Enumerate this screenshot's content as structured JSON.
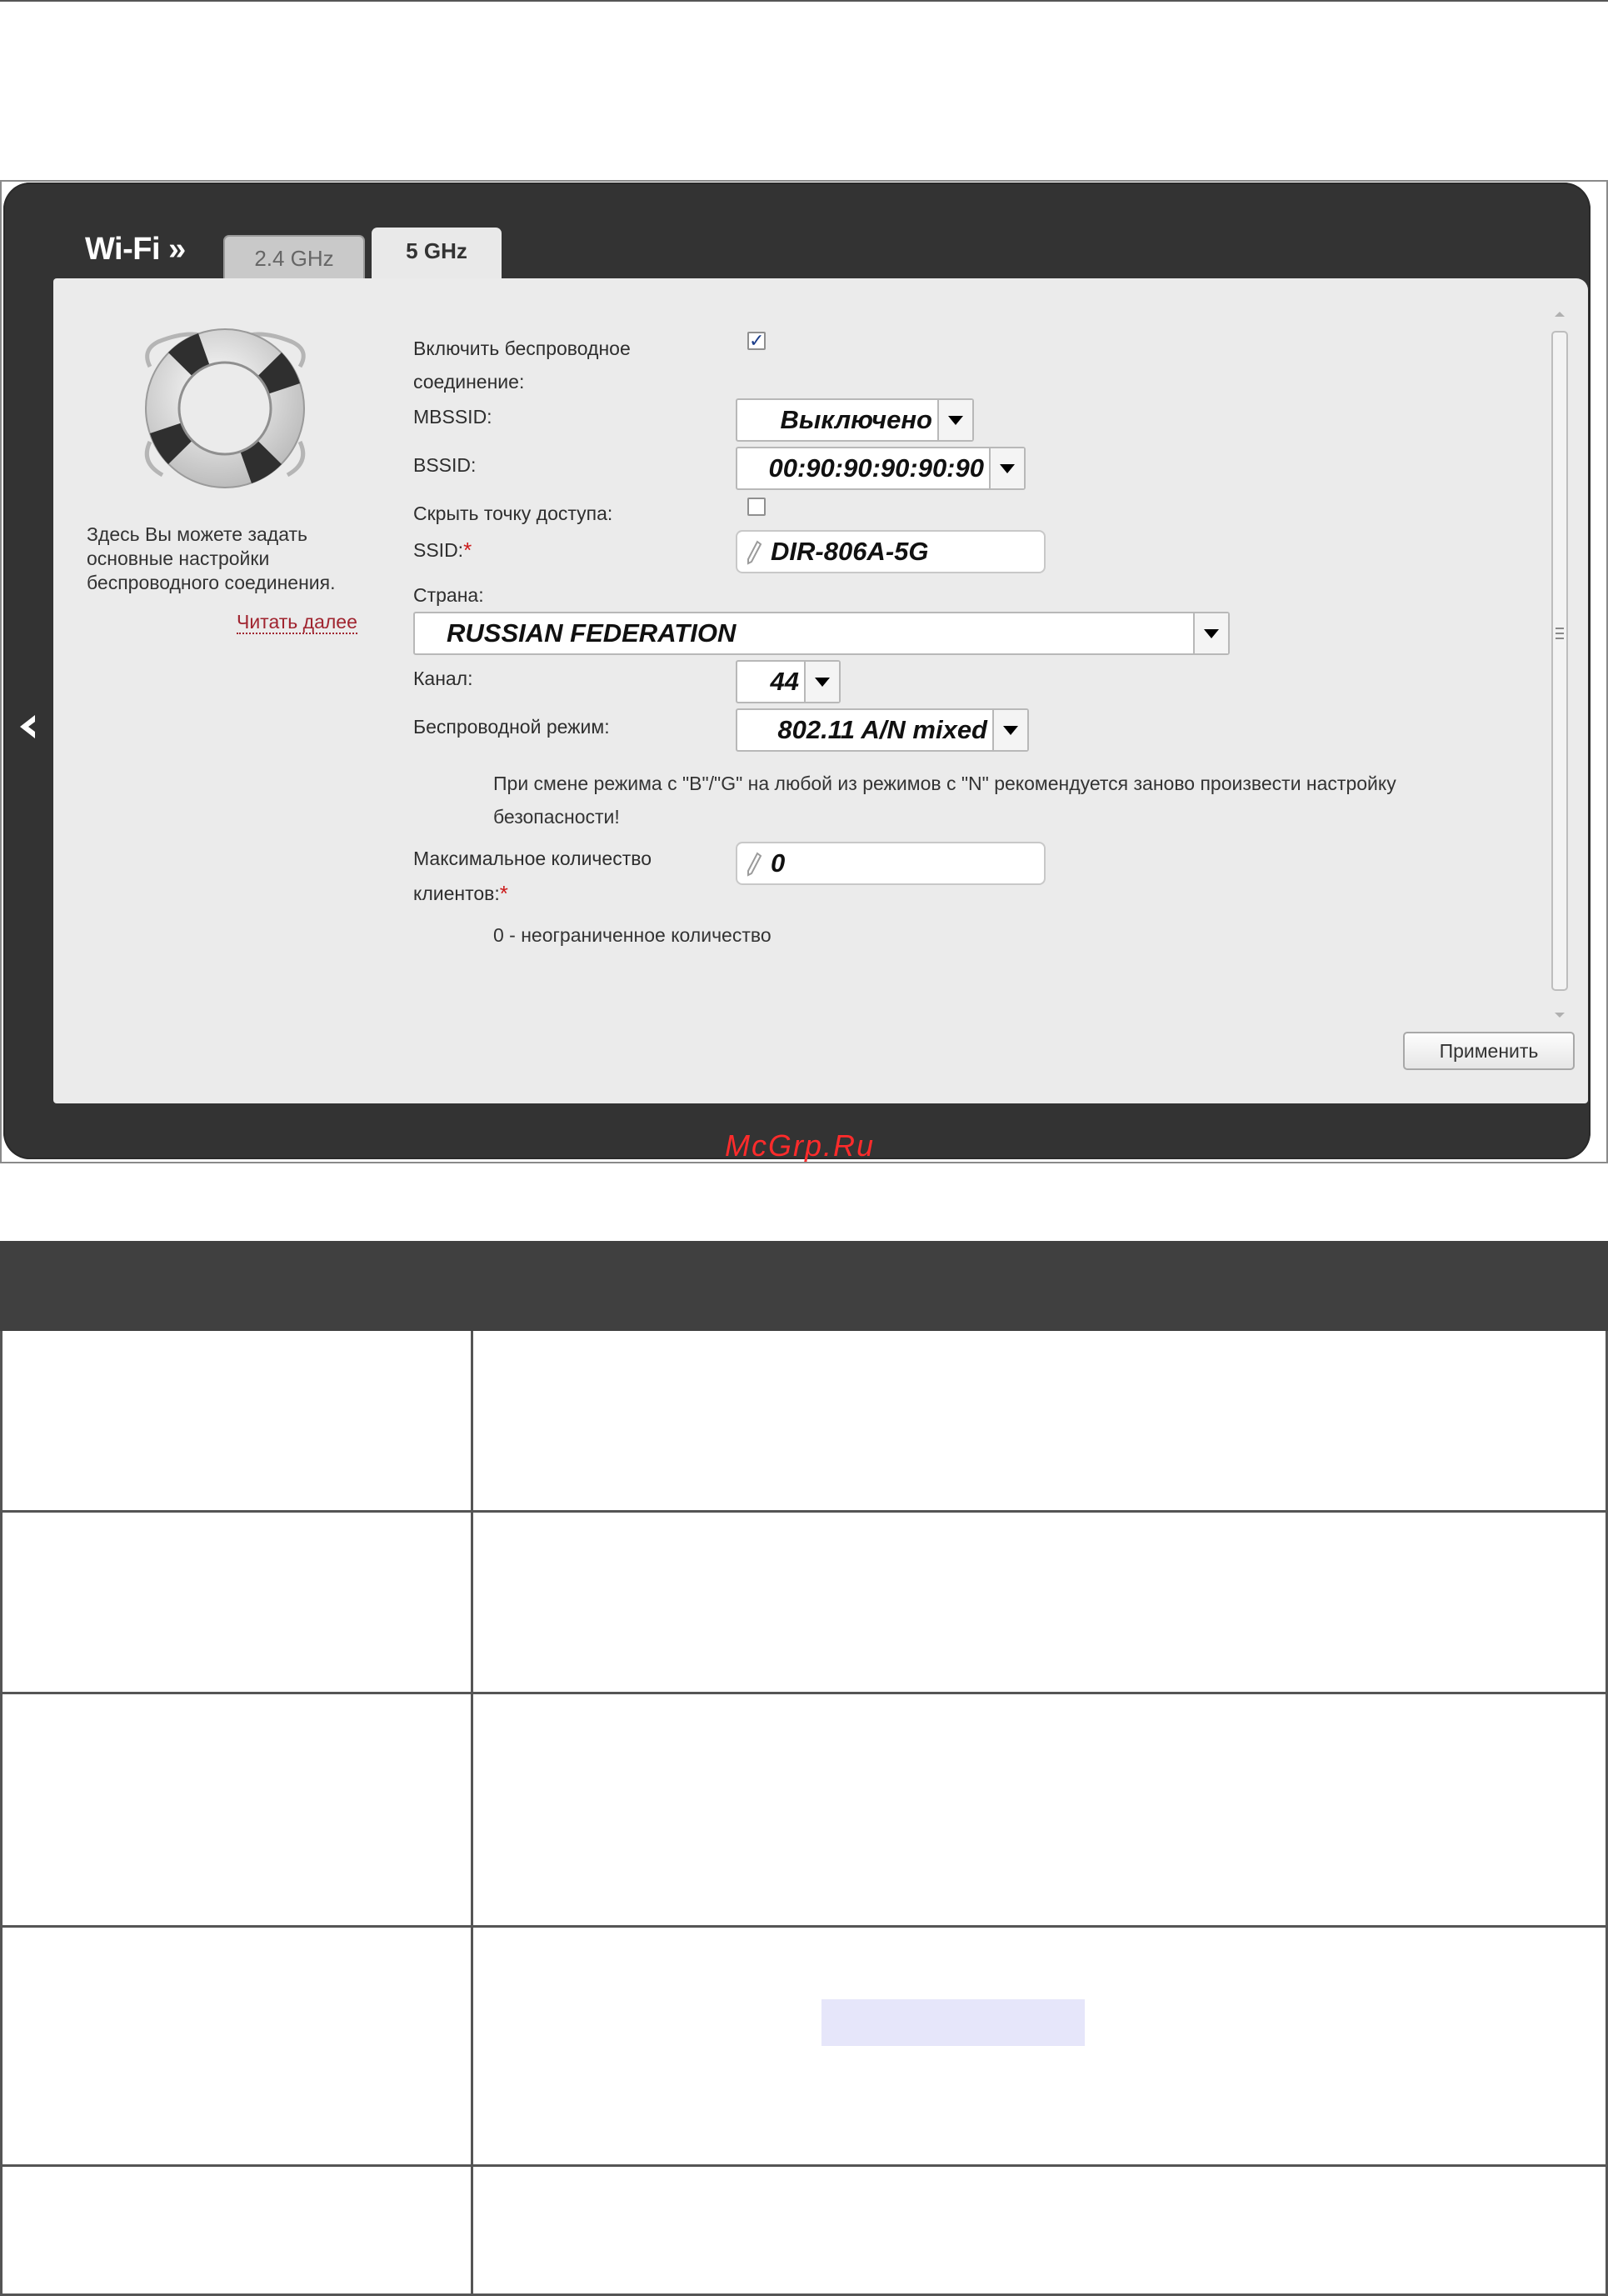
{
  "header": {
    "section_title": "Wi-Fi »"
  },
  "tabs": [
    {
      "label": "2.4 GHz",
      "active": false
    },
    {
      "label": "5 GHz",
      "active": true
    }
  ],
  "sidebar": {
    "icon": "lifebuoy-icon",
    "help_text": "Здесь Вы можете задать основные настройки беспроводного соединения.",
    "read_more": "Читать далее"
  },
  "form": {
    "enable_wireless": {
      "label": "Включить беспроводное соединение:",
      "checked": true
    },
    "mbssid": {
      "label": "MBSSID:",
      "value": "Выключено"
    },
    "bssid": {
      "label": "BSSID:",
      "value": "00:90:90:90:90:90"
    },
    "hide_ap": {
      "label": "Скрыть точку доступа:",
      "checked": false
    },
    "ssid": {
      "label": "SSID:",
      "required_mark": "*",
      "value": "DIR-806A-5G"
    },
    "country": {
      "label": "Страна:",
      "value": "RUSSIAN FEDERATION"
    },
    "channel": {
      "label": "Канал:",
      "value": "44"
    },
    "wireless_mode": {
      "label": "Беспроводной режим:",
      "value": "802.11 A/N mixed"
    },
    "mode_note": "При смене режима с \"B\"/\"G\" на любой из режимов с \"N\" рекомендуется заново произвести настройку безопасности!",
    "max_clients": {
      "label_line1": "Максимальное количество",
      "label_line2": "клиентов:",
      "required_mark": "*",
      "value": "0"
    },
    "max_clients_note": "0 - неограниченное количество"
  },
  "apply_button": "Применить",
  "watermark": "McGrp.Ru",
  "colors": {
    "frame": "#333333",
    "panel": "#ebebeb",
    "link": "#a0242f",
    "required": "#cc1b1b",
    "table_header": "#404040",
    "highlight": "#e6e6fa"
  }
}
